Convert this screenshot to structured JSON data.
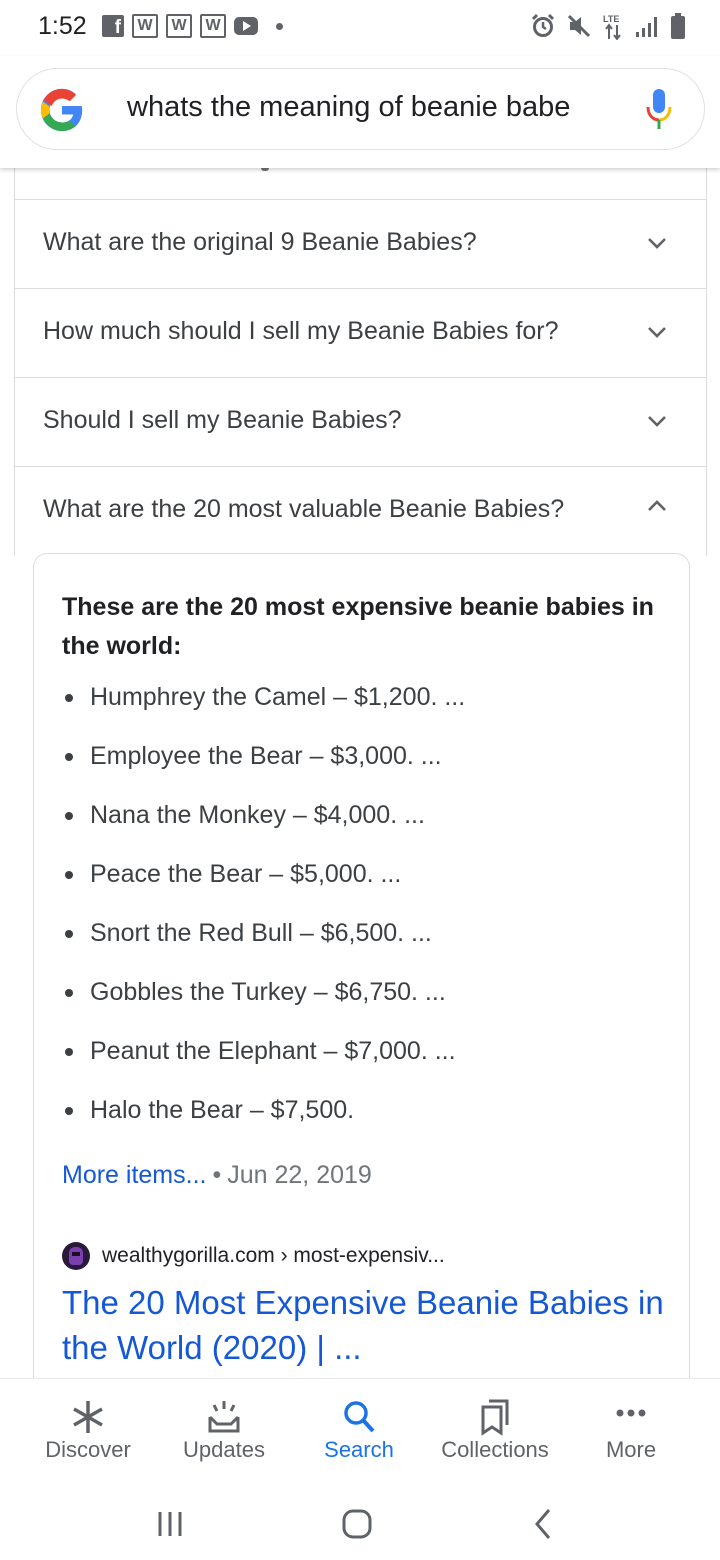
{
  "status_bar": {
    "time": "1:52",
    "fb_glyph": "f",
    "w_glyph": "W",
    "left_icons": [
      "facebook-icon",
      "w-app-icon",
      "w-app-icon",
      "w-app-icon",
      "youtube-icon",
      "notification-dot-icon"
    ],
    "right_icons": [
      "alarm-icon",
      "mute-icon",
      "data-arrows-icon",
      "signal-icon",
      "battery-icon"
    ]
  },
  "search": {
    "query": "whats the meaning of beanie babe",
    "logo": "google-g-icon",
    "mic": "mic-icon"
  },
  "faq": {
    "items": [
      {
        "question": "What are the original 9 Beanie Babies?",
        "expanded": false
      },
      {
        "question": "How much should I sell my Beanie Babies for?",
        "expanded": false
      },
      {
        "question": "Should I sell my Beanie Babies?",
        "expanded": false
      },
      {
        "question": "What are the 20 most valuable Beanie Babies?",
        "expanded": true
      }
    ]
  },
  "answer": {
    "title": "These are the 20 most expensive beanie babies in the world:",
    "list": [
      "Humphrey the Camel – $1,200. ...",
      "Employee the Bear – $3,000. ...",
      "Nana the Monkey – $4,000. ...",
      "Peace the Bear – $5,000. ...",
      "Snort the Red Bull – $6,500. ...",
      "Gobbles the Turkey – $6,750. ...",
      "Peanut the Elephant – $7,000. ...",
      "Halo the Bear – $7,500."
    ],
    "more_items": "More items...",
    "separator": "•",
    "date": "Jun 22, 2019",
    "source": "wealthygorilla.com › most-expensiv...",
    "result_title": "The 20 Most Expensive Beanie Babies in the World (2020) | ..."
  },
  "bottom_nav": {
    "discover": "Discover",
    "updates": "Updates",
    "search": "Search",
    "collections": "Collections",
    "more": "More",
    "active": "Search"
  },
  "colors": {
    "link_blue": "#1558d6",
    "active_blue": "#1a73e8",
    "text_primary": "#202124",
    "text_secondary": "#5f6368",
    "divider": "#dadce0"
  }
}
